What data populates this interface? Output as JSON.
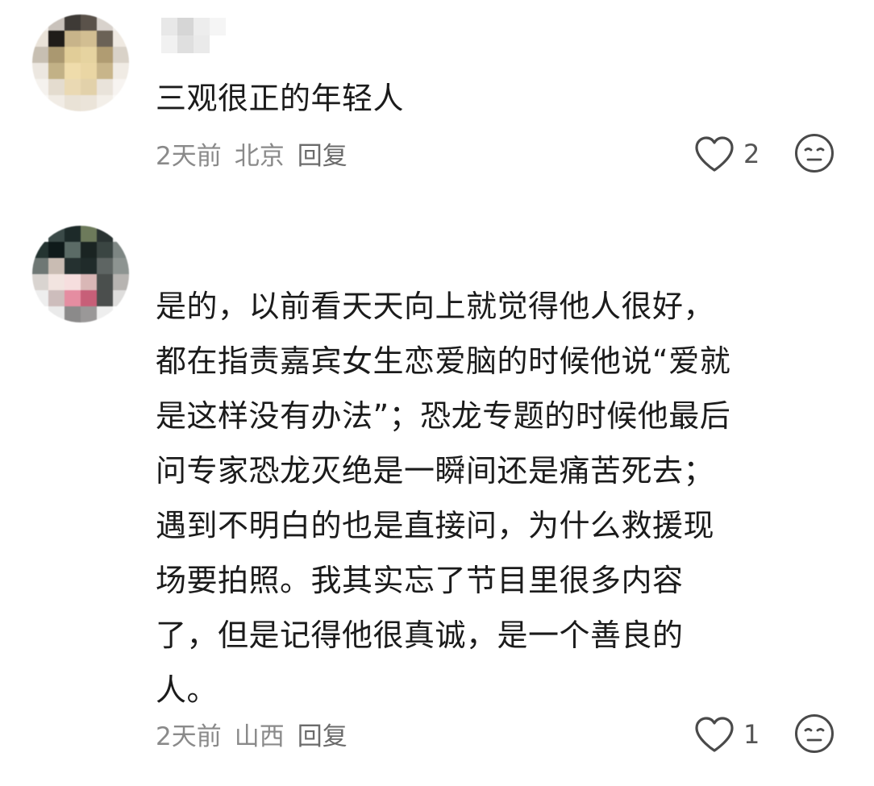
{
  "comments": [
    {
      "text": "三观很正的年轻人",
      "time": "2天前",
      "location": "北京",
      "reply_label": "回复",
      "like_count": "2",
      "like_icon": "heart-outline-icon",
      "dislike_icon": "meh-face-icon"
    },
    {
      "text": "是的，以前看天天向上就觉得他人很好，\n都在指责嘉宾女生恋爱脑的时候他说“爱就\n是这样没有办法”；恐龙专题的时候他最后\n问专家恐龙灭绝是一瞬间还是痛苦死去；\n遇到不明白的也是直接问，为什么救援现\n场要拍照。我其实忘了节目里很多内容\n了，但是记得他很真诚，是一个善良的\n人。",
      "time": "2天前",
      "location": "山西",
      "reply_label": "回复",
      "like_count": "1",
      "like_icon": "heart-outline-icon",
      "dislike_icon": "meh-face-icon"
    }
  ],
  "colors": {
    "text": "#1b1b1b",
    "meta": "#8a8a8a",
    "icon": "#4a4a4a"
  }
}
